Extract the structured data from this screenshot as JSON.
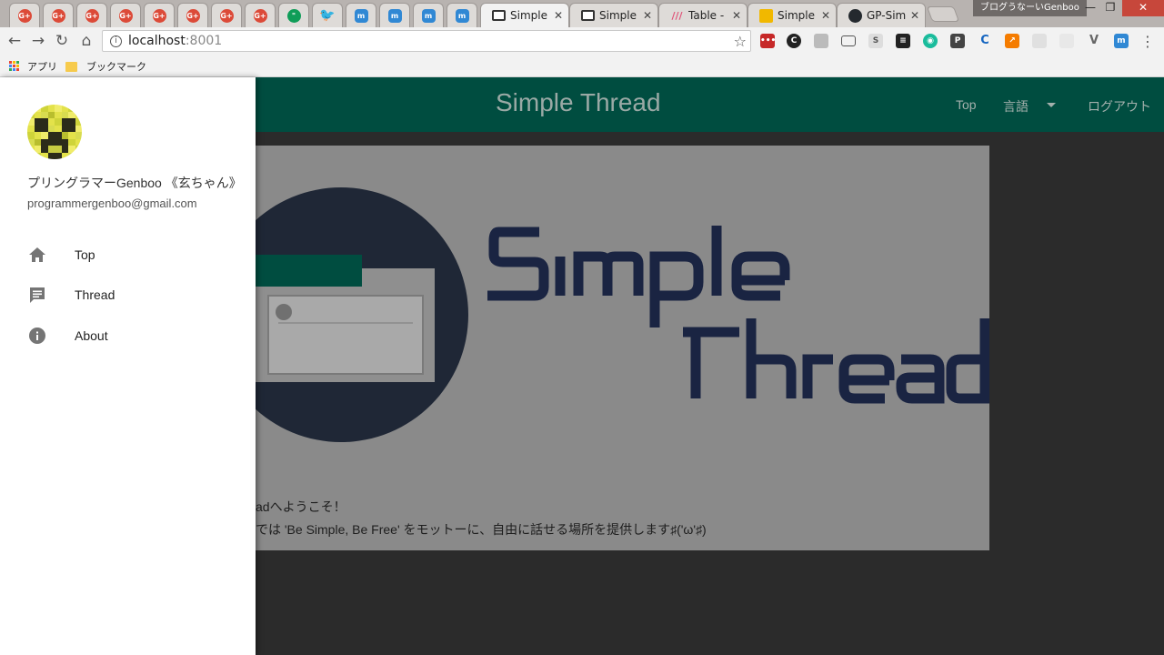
{
  "browser": {
    "tabs": [
      {
        "favicon": "google-plus-icon",
        "title": ""
      },
      {
        "favicon": "google-plus-icon",
        "title": ""
      },
      {
        "favicon": "google-plus-icon",
        "title": ""
      },
      {
        "favicon": "google-plus-icon",
        "title": ""
      },
      {
        "favicon": "google-plus-icon",
        "title": ""
      },
      {
        "favicon": "google-plus-icon",
        "title": ""
      },
      {
        "favicon": "google-plus-icon",
        "title": ""
      },
      {
        "favicon": "google-plus-icon",
        "title": ""
      },
      {
        "favicon": "hangouts-icon",
        "title": ""
      },
      {
        "favicon": "twitter-icon",
        "title": ""
      },
      {
        "favicon": "mastodon-icon",
        "title": ""
      },
      {
        "favicon": "mastodon-icon",
        "title": ""
      },
      {
        "favicon": "mastodon-icon",
        "title": ""
      },
      {
        "favicon": "mastodon-icon",
        "title": ""
      },
      {
        "favicon": "simple-thread-icon",
        "title": "Simple"
      },
      {
        "favicon": "simple-thread-icon",
        "title": "Simple"
      },
      {
        "favicon": "table-icon",
        "title": "Table - "
      },
      {
        "favicon": "simple-icon",
        "title": "Simple"
      },
      {
        "favicon": "github-icon",
        "title": "GP-Sim"
      }
    ],
    "profile_name": "ブログうなーいGenboo",
    "window_buttons": {
      "minimize": "—",
      "maximize": "❐",
      "close": "✕"
    },
    "address": {
      "host": "localhost",
      "port": ":8001"
    },
    "bookmarks": {
      "apps": "アプリ",
      "folder": "ブックマーク"
    }
  },
  "app": {
    "brand": "Simple Thread",
    "nav": {
      "top": "Top",
      "language": "言語",
      "logout": "ログアウト"
    },
    "welcome": {
      "line1": "adへようこそ！",
      "line2": "では 'Be Simple, Be Free' をモットーに、自由に話せる場所を提供します♯('ω'♯)"
    }
  },
  "drawer": {
    "user_name": "プリングラマーGenboo 《玄ちゃん》",
    "user_email": "programmergenboo@gmail.com",
    "items": [
      {
        "icon": "home-icon",
        "label": "Top"
      },
      {
        "icon": "comment-icon",
        "label": "Thread"
      },
      {
        "icon": "info-icon",
        "label": "About"
      }
    ]
  },
  "colors": {
    "appbar": "#004d40",
    "drawer_icons": "#757575",
    "logo_navy": "#1c2a4a",
    "logo_teal": "#00695c"
  }
}
